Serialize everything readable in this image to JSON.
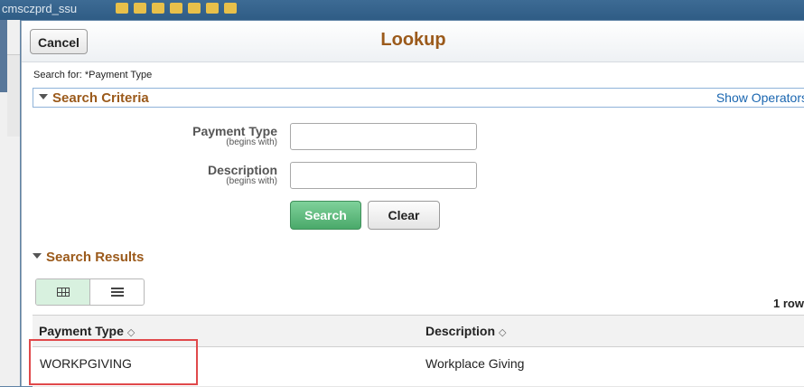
{
  "background": {
    "app_title": "cmsczprd_ssu"
  },
  "modal": {
    "cancel_label": "Cancel",
    "title": "Lookup",
    "search_for": "Search for:  *Payment Type"
  },
  "criteria": {
    "title": "Search Criteria",
    "show_operators": "Show Operators",
    "fields": [
      {
        "label": "Payment Type",
        "sub": "(begins with)",
        "value": ""
      },
      {
        "label": "Description",
        "sub": "(begins with)",
        "value": ""
      }
    ],
    "search_label": "Search",
    "clear_label": "Clear"
  },
  "results": {
    "title": "Search Results",
    "row_count": "1 row",
    "columns": [
      "Payment Type",
      "Description"
    ],
    "rows": [
      {
        "payment_type": "WORKPGIVING",
        "description": "Workplace Giving"
      }
    ]
  },
  "colors": {
    "section_title": "#9b5a1b",
    "link": "#1a66b0",
    "search_button": "#4aa96a",
    "highlight": "#e0494b"
  }
}
